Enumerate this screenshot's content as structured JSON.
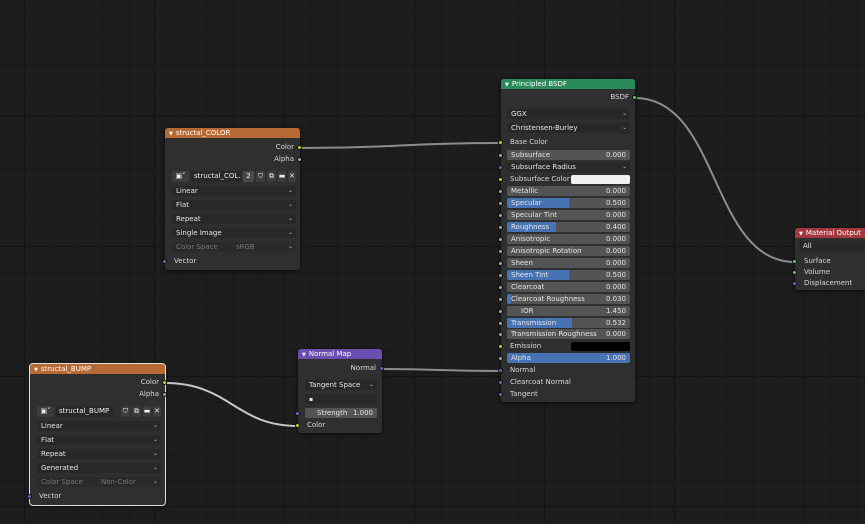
{
  "colors": {
    "link": "#8d8d8d",
    "header_image": "#b86a35",
    "header_shader": "#2a8a59",
    "header_vector": "#6a4fb0",
    "header_output": "#a5383f",
    "slider_fill": "#4772b3"
  },
  "color_image": {
    "title": "structal_COLOR",
    "outputs": [
      "Color",
      "Alpha"
    ],
    "image_name": "structal_COL...",
    "users": "2",
    "interpolation": "Linear",
    "projection": "Flat",
    "extension": "Repeat",
    "source": "Single Image",
    "color_space_label": "Color Space",
    "color_space_value": "sRGB",
    "input": "Vector"
  },
  "bump_image": {
    "title": "structal_BUMP",
    "outputs": [
      "Color",
      "Alpha"
    ],
    "image_name": "structal_BUMP",
    "interpolation": "Linear",
    "projection": "Flat",
    "extension": "Repeat",
    "source": "Generated",
    "color_space_label": "Color Space",
    "color_space_value": "Non-Color",
    "input": "Vector"
  },
  "normal_map": {
    "title": "Normal Map",
    "output": "Normal",
    "space": "Tangent Space",
    "uv_map": "",
    "strength_label": "Strength",
    "strength_value": "1.000",
    "input_color": "Color"
  },
  "principled": {
    "title": "Principled BSDF",
    "output": "BSDF",
    "distribution": "GGX",
    "subsurface_method": "Christensen-Burley",
    "base_color": "Base Color",
    "subsurface_radius": "Subsurface Radius",
    "subsurface_color": "Subsurface Color",
    "subsurface_color_hex": "#f0f0f0",
    "emission_label": "Emission",
    "emission_hex": "#000000",
    "sliders": [
      {
        "label": "Subsurface",
        "value": "0.000",
        "fill": 0.0
      },
      {
        "label": "Metallic",
        "value": "0.000",
        "fill": 0.0
      },
      {
        "label": "Specular",
        "value": "0.500",
        "fill": 0.5
      },
      {
        "label": "Specular Tint",
        "value": "0.000",
        "fill": 0.0
      },
      {
        "label": "Roughness",
        "value": "0.400",
        "fill": 0.4
      },
      {
        "label": "Anisotropic",
        "value": "0.000",
        "fill": 0.0
      },
      {
        "label": "Anisotropic Rotation",
        "value": "0.000",
        "fill": 0.0
      },
      {
        "label": "Sheen",
        "value": "0.000",
        "fill": 0.0
      },
      {
        "label": "Sheen Tint",
        "value": "0.500",
        "fill": 0.5
      },
      {
        "label": "Clearcoat",
        "value": "0.000",
        "fill": 0.0
      },
      {
        "label": "Clearcoat Roughness",
        "value": "0.030",
        "fill": 0.03
      },
      {
        "label": "IOR",
        "value": "1.450",
        "fill": 0.0
      },
      {
        "label": "Transmission",
        "value": "0.532",
        "fill": 0.532
      },
      {
        "label": "Transmission Roughness",
        "value": "0.000",
        "fill": 0.0
      }
    ],
    "alpha_label": "Alpha",
    "alpha_value": "1.000",
    "alpha_fill": 1.0,
    "inputs_tail": [
      "Normal",
      "Clearcoat Normal",
      "Tangent"
    ]
  },
  "material_output": {
    "title": "Material Output",
    "target": "All",
    "inputs": [
      "Surface",
      "Volume",
      "Displacement"
    ]
  }
}
